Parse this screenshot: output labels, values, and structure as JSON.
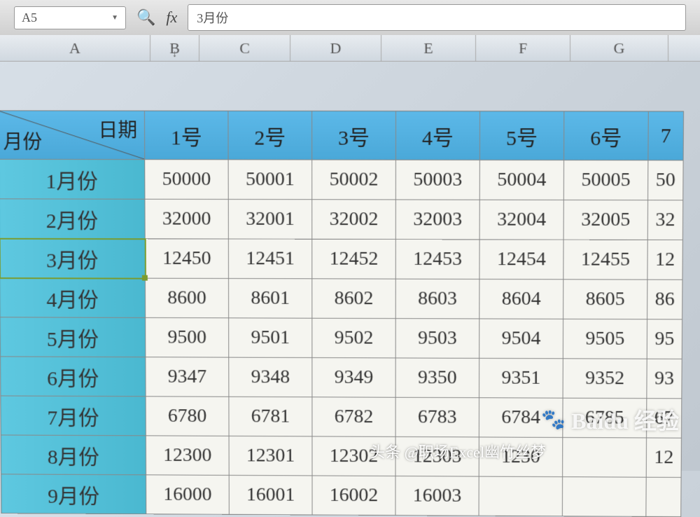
{
  "toolbar": {
    "cell_reference": "A5",
    "formula_value": "3月份"
  },
  "column_headers": [
    "A",
    "B",
    "C",
    "D",
    "E",
    "F",
    "G"
  ],
  "diagonal_header": {
    "left": "月份",
    "right": "日期"
  },
  "day_headers": [
    "1号",
    "2号",
    "3号",
    "4号",
    "5号",
    "6号",
    "7"
  ],
  "rows": [
    {
      "month": "1月份",
      "values": [
        "50000",
        "50001",
        "50002",
        "50003",
        "50004",
        "50005",
        "50"
      ]
    },
    {
      "month": "2月份",
      "values": [
        "32000",
        "32001",
        "32002",
        "32003",
        "32004",
        "32005",
        "32"
      ]
    },
    {
      "month": "3月份",
      "values": [
        "12450",
        "12451",
        "12452",
        "12453",
        "12454",
        "12455",
        "12"
      ],
      "selected": true
    },
    {
      "month": "4月份",
      "values": [
        "8600",
        "8601",
        "8602",
        "8603",
        "8604",
        "8605",
        "86"
      ]
    },
    {
      "month": "5月份",
      "values": [
        "9500",
        "9501",
        "9502",
        "9503",
        "9504",
        "9505",
        "95"
      ]
    },
    {
      "month": "6月份",
      "values": [
        "9347",
        "9348",
        "9349",
        "9350",
        "9351",
        "9352",
        "93"
      ]
    },
    {
      "month": "7月份",
      "values": [
        "6780",
        "6781",
        "6782",
        "6783",
        "6784",
        "6785",
        "67"
      ]
    },
    {
      "month": "8月份",
      "values": [
        "12300",
        "12301",
        "12302",
        "12303",
        "1230",
        "",
        "12"
      ]
    },
    {
      "month": "9月份",
      "values": [
        "16000",
        "16001",
        "16002",
        "16003",
        "",
        "",
        ""
      ]
    }
  ],
  "watermarks": {
    "baidu": "Baidu 经验",
    "baidu_logo": "Bai",
    "baidu_suffix": "经验",
    "toutiao": "头条 @职场Excel幽竹丝梦"
  }
}
